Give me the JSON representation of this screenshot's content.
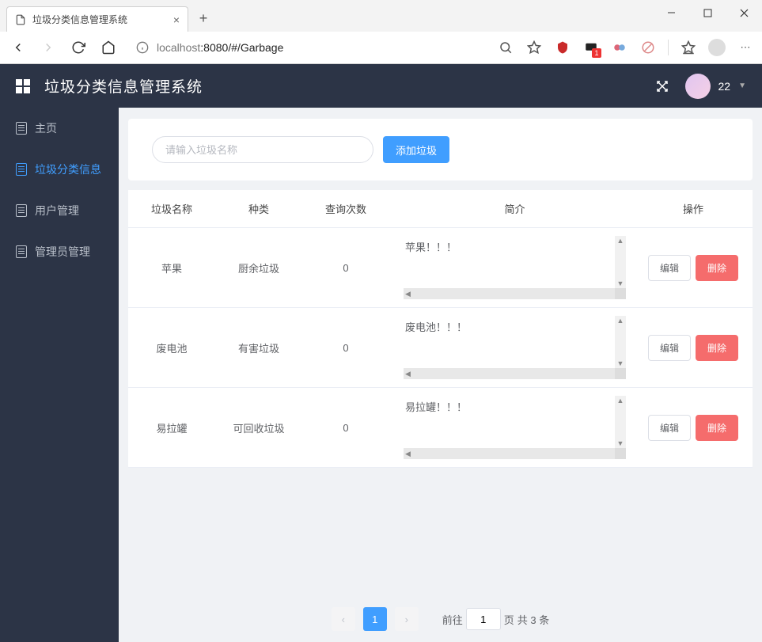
{
  "browser": {
    "tab_title": "垃圾分类信息管理系统",
    "url_host": "localhost",
    "url_port": ":8080",
    "url_path": "/#/Garbage"
  },
  "header": {
    "app_title": "垃圾分类信息管理系统",
    "user_label": "22"
  },
  "sidebar": {
    "items": [
      {
        "label": "主页"
      },
      {
        "label": "垃圾分类信息"
      },
      {
        "label": "用户管理"
      },
      {
        "label": "管理员管理"
      }
    ]
  },
  "search": {
    "placeholder": "请输入垃圾名称",
    "add_label": "添加垃圾"
  },
  "table": {
    "headers": [
      "垃圾名称",
      "种类",
      "查询次数",
      "简介",
      "操作"
    ],
    "edit_label": "编辑",
    "delete_label": "删除",
    "rows": [
      {
        "name": "苹果",
        "type": "厨余垃圾",
        "count": "0",
        "intro": "苹果！！！"
      },
      {
        "name": "废电池",
        "type": "有害垃圾",
        "count": "0",
        "intro": "废电池！！！"
      },
      {
        "name": "易拉罐",
        "type": "可回收垃圾",
        "count": "0",
        "intro": "易拉罐！！！"
      }
    ]
  },
  "pagination": {
    "current": "1",
    "goto_prefix": "前往",
    "goto_input": "1",
    "goto_suffix": "页",
    "total_text": "共 3 条"
  }
}
